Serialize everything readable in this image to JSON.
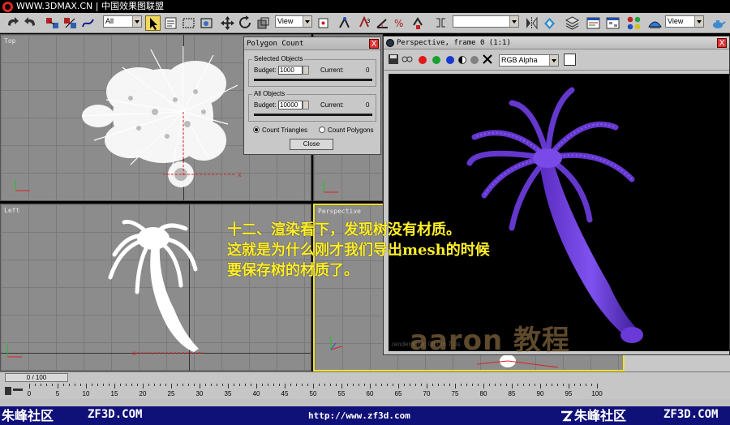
{
  "banner": {
    "text": "WWW.3DMAX.CN | 中国效果图联盟"
  },
  "toolbar": {
    "selection_filter": "All",
    "reference_coord": "View",
    "named_selection": "",
    "coord_right": "View"
  },
  "viewports": {
    "top_label": "Top",
    "left_label": "Left",
    "perspective_label": "Perspective"
  },
  "polygon_dialog": {
    "title": "Polygon Count",
    "selected_group": "Selected Objects",
    "all_group": "All Objects",
    "budget_label": "Budget:",
    "current_label": "Current:",
    "selected_budget": "1000",
    "selected_current": "0",
    "all_budget": "10000",
    "all_current": "0",
    "count_triangles": "Count Triangles",
    "count_polygons": "Count Polygons",
    "close_label": "Close",
    "close_x": "X"
  },
  "render_window": {
    "title": "Perspective, frame 0 (1:1)",
    "channel": "RGB Alpha",
    "close_x": "X",
    "render_time": "render time: 0h 0m 7.3s"
  },
  "caption": {
    "line1": "十二、渲染看下，发现树没有材质。",
    "line2": "这就是为什么刚才我们导出mesh的时候",
    "line3": "要保存树的材质了。"
  },
  "watermark": {
    "text": "aaron  教程"
  },
  "timeline": {
    "slider": "0 / 100",
    "ticks": [
      "0",
      "5",
      "10",
      "15",
      "20",
      "25",
      "30",
      "35",
      "40",
      "45",
      "50",
      "55",
      "60",
      "65",
      "70",
      "75",
      "80",
      "85",
      "90",
      "95",
      "100"
    ]
  },
  "footer": {
    "left_brand": "朱峰社区",
    "left_site": "ZF3D.COM",
    "url": "http://www.zf3d.com",
    "right_brand": "朱峰社区",
    "right_site": "ZF3D.COM"
  },
  "colors": {
    "toolbar_bg": "#c7c7c7",
    "viewport_bg": "#8c8c8c",
    "active_viewport_border": "#f0e030",
    "render_bg": "#000000",
    "palm_purple": "#6a3ad8",
    "caption_yellow": "#ffef2a",
    "footer_bg": "#0f1078"
  },
  "icons": [
    "undo-icon",
    "redo-icon",
    "link-icon",
    "unlink-icon",
    "bind-space-warp-icon",
    "select-cursor-icon",
    "select-by-name-icon",
    "rectangle-region-icon",
    "window-crossing-icon",
    "move-icon",
    "rotate-icon",
    "scale-icon",
    "mirror-icon",
    "align-icon",
    "material-editor-icon",
    "render-scene-icon",
    "quick-render-icon",
    "teapot-icon"
  ]
}
